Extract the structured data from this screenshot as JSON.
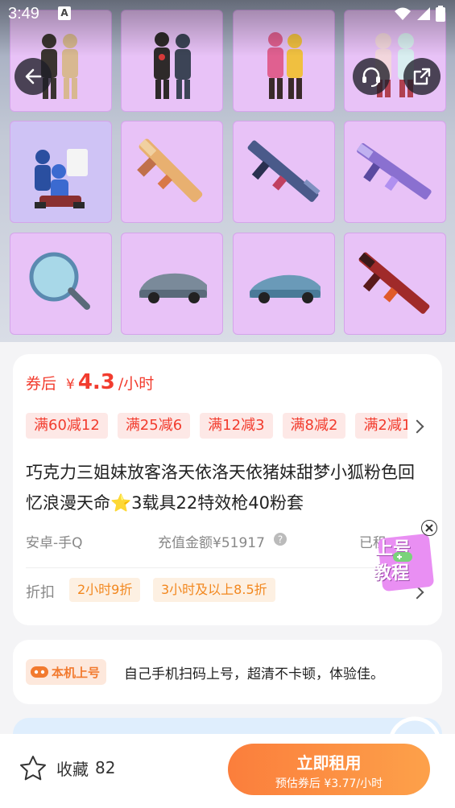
{
  "status_bar": {
    "time": "3:49",
    "notif_letter": "A"
  },
  "gallery": {
    "tiles": [
      {
        "name": "outfit-duo-1",
        "selected": false
      },
      {
        "name": "outfit-duo-2",
        "selected": false
      },
      {
        "name": "outfit-duo-3",
        "selected": false
      },
      {
        "name": "outfit-duo-4",
        "selected": false
      },
      {
        "name": "outfit-group",
        "selected": true
      },
      {
        "name": "rifle-gold",
        "selected": false
      },
      {
        "name": "rifle-blue",
        "selected": false
      },
      {
        "name": "rifle-purple",
        "selected": false
      },
      {
        "name": "frying-pan",
        "selected": false
      },
      {
        "name": "car-silver",
        "selected": false
      },
      {
        "name": "car-blue",
        "selected": false
      },
      {
        "name": "rifle-red",
        "selected": false
      }
    ]
  },
  "price": {
    "label": "券后",
    "currency": "¥",
    "value": "4.3",
    "unit": "/小时"
  },
  "coupons": [
    "满60减12",
    "满25减6",
    "满12减3",
    "满8减2",
    "满2减1"
  ],
  "title": "巧克力三姐妹放客洛天依洛天依猪妹甜梦小狐粉色回忆浪漫天命⭐3载具22特效枪40粉套",
  "meta": {
    "platform": "安卓-手Q",
    "recharge": "充值金额¥51917",
    "rented": "已租"
  },
  "discount": {
    "label": "折扣",
    "tags": [
      "2小时9折",
      "3小时及以上8.5折"
    ]
  },
  "float_badge": {
    "line1": "上号",
    "line2": "教程"
  },
  "login": {
    "badge": "本机上号",
    "desc": "自己手机扫码上号，超清不卡顿，体验佳。"
  },
  "bottom_bar": {
    "favorite_label": "收藏",
    "favorite_count": "82",
    "rent_label": "立即租用",
    "rent_sub": "预估券后 ¥3.77/小时"
  },
  "colors": {
    "accent": "#f23c2e",
    "orange": "#fb8a3e",
    "tile": "#e8c2f7"
  }
}
